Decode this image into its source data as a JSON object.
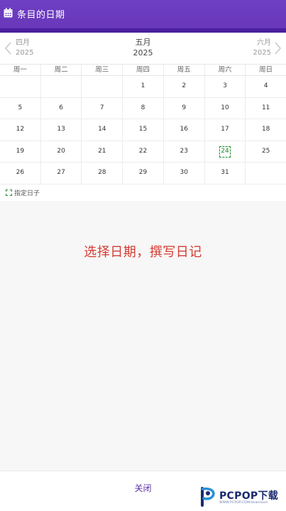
{
  "header": {
    "title": "条目的日期",
    "icon": "calendar-icon"
  },
  "month_nav": {
    "prev": {
      "month": "四月",
      "year": "2025"
    },
    "current": {
      "month": "五月",
      "year": "2025"
    },
    "next": {
      "month": "六月",
      "year": "2025"
    }
  },
  "weekdays": [
    "周一",
    "周二",
    "周三",
    "周四",
    "周五",
    "周六",
    "周日"
  ],
  "weeks": [
    [
      "",
      "",
      "",
      "1",
      "2",
      "3",
      "4"
    ],
    [
      "5",
      "6",
      "7",
      "8",
      "9",
      "10",
      "11"
    ],
    [
      "12",
      "13",
      "14",
      "15",
      "16",
      "17",
      "18"
    ],
    [
      "19",
      "20",
      "21",
      "22",
      "23",
      "24",
      "25"
    ],
    [
      "26",
      "27",
      "28",
      "29",
      "30",
      "31",
      ""
    ]
  ],
  "marked_day": "24",
  "legend": {
    "label": "指定日子",
    "color": "#1b8a2a"
  },
  "content": {
    "promo_text": "选择日期，撰写日记"
  },
  "footer": {
    "close_label": "关闭"
  },
  "watermark": {
    "brand": "PCPOP下载",
    "sub": "WWW.PCPOP.COM/download"
  },
  "colors": {
    "header": "#6f3fc4",
    "accent": "#5a2fa6",
    "promo": "#d63a32"
  }
}
